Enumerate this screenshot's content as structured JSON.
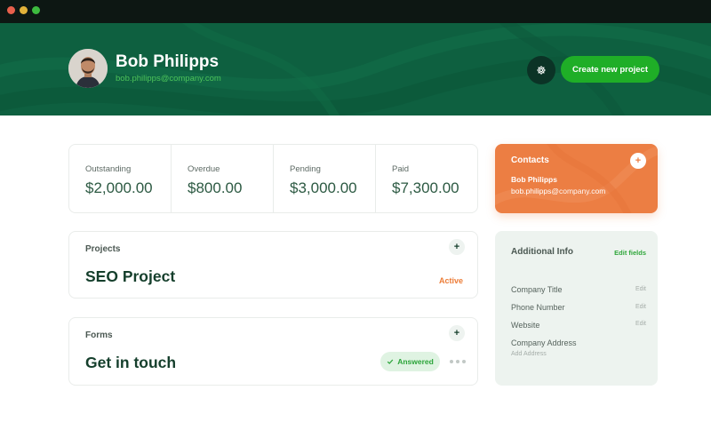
{
  "window": {
    "controls": [
      "close",
      "minimize",
      "maximize"
    ]
  },
  "header": {
    "user_name": "Bob Philipps",
    "user_email": "bob.philipps@company.com",
    "settings_icon": "gear-icon",
    "create_label": "Create new project"
  },
  "stats": [
    {
      "label": "Outstanding",
      "value": "$2,000.00"
    },
    {
      "label": "Overdue",
      "value": "$800.00"
    },
    {
      "label": "Pending",
      "value": "$3,000.00"
    },
    {
      "label": "Paid",
      "value": "$7,300.00"
    }
  ],
  "projects": {
    "label": "Projects",
    "add": "+",
    "title": "SEO Project",
    "status": "Active"
  },
  "forms": {
    "label": "Forms",
    "add": "+",
    "title": "Get in touch",
    "status": "Answered",
    "status_icon": "check-icon"
  },
  "contacts": {
    "title": "Contacts",
    "add": "+",
    "name": "Bob Philipps",
    "email": "bob.philipps@company.com"
  },
  "additional_info": {
    "title": "Additional Info",
    "edit_fields": "Edit fields",
    "rows": [
      {
        "label": "Company Title",
        "edit": "Edit"
      },
      {
        "label": "Phone Number",
        "edit": "Edit"
      },
      {
        "label": "Website",
        "edit": "Edit"
      },
      {
        "label": "Company Address",
        "sub": "Add Address"
      }
    ]
  },
  "colors": {
    "header_bg": "#0e6040",
    "accent_green": "#1fae27",
    "accent_orange": "#ec7e43",
    "text_dark_green": "#153f2c"
  }
}
